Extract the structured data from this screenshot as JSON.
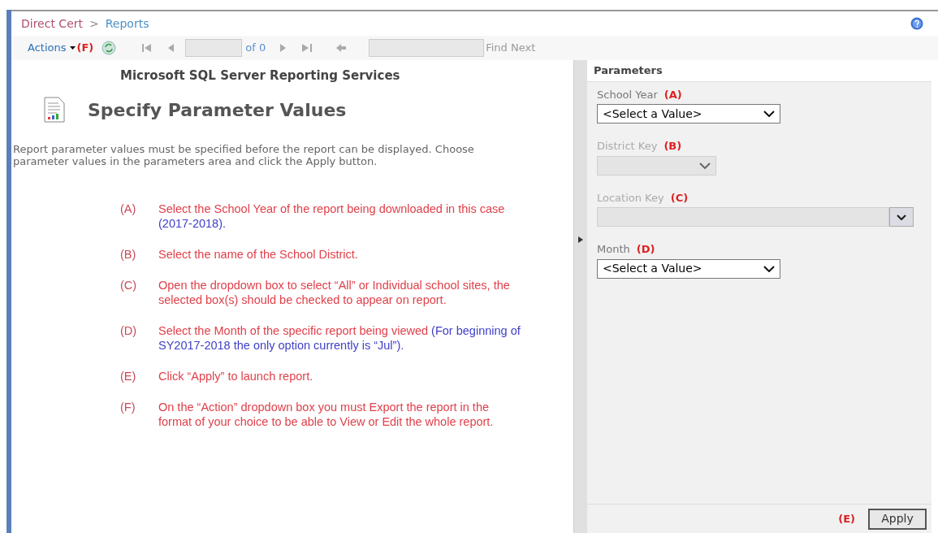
{
  "breadcrumb": [
    {
      "label": "Direct Cert",
      "kind": "link"
    },
    {
      "label": ">",
      "kind": "separator"
    },
    {
      "label": "Reports",
      "kind": "current"
    }
  ],
  "toolbar": {
    "actions": "Actions",
    "actions_marker": "(F)",
    "page_of": "of 0",
    "find_next": "Find Next"
  },
  "report": {
    "heading": "Microsoft SQL Server Reporting Services",
    "title": "Specify Parameter Values",
    "description": "Report parameter values must be specified before the report can be displayed. Choose parameter values in the parameters area and click the Apply button.",
    "instructions": [
      {
        "letter": "(A)",
        "text": "Select the School Year of the report being downloaded in this case",
        "note": "(2017-2018)."
      },
      {
        "letter": "(B)",
        "text": "Select the name of the School District."
      },
      {
        "letter": "(C)",
        "text": "Open the dropdown box to select “All” or Individual school sites, the selected box(s) should be checked to appear on report."
      },
      {
        "letter": "(D)",
        "text": "Select the Month of the specific report being viewed",
        "note": "(For beginning of SY2017-2018 the only option currently is “Jul”)."
      },
      {
        "letter": "(E)",
        "text": "Click “Apply” to launch report."
      },
      {
        "letter": "(F)",
        "text": "On the “Action” dropdown box you must Export the report in the format of your choice to be able to View or Edit the whole report."
      }
    ]
  },
  "parameters": {
    "title": "Parameters",
    "fields": [
      {
        "label": "School Year",
        "marker": "(A)",
        "kind": "select",
        "disabled": false,
        "value": "<Select a Value>"
      },
      {
        "label": "District Key",
        "marker": "(B)",
        "kind": "select",
        "disabled": true
      },
      {
        "label": "Location Key",
        "marker": "(C)",
        "kind": "multiselect",
        "disabled": true
      },
      {
        "label": "Month",
        "marker": "(D)",
        "kind": "select",
        "disabled": false,
        "value": "<Select a Value>"
      }
    ],
    "apply_marker": "(E)",
    "apply": "Apply"
  }
}
